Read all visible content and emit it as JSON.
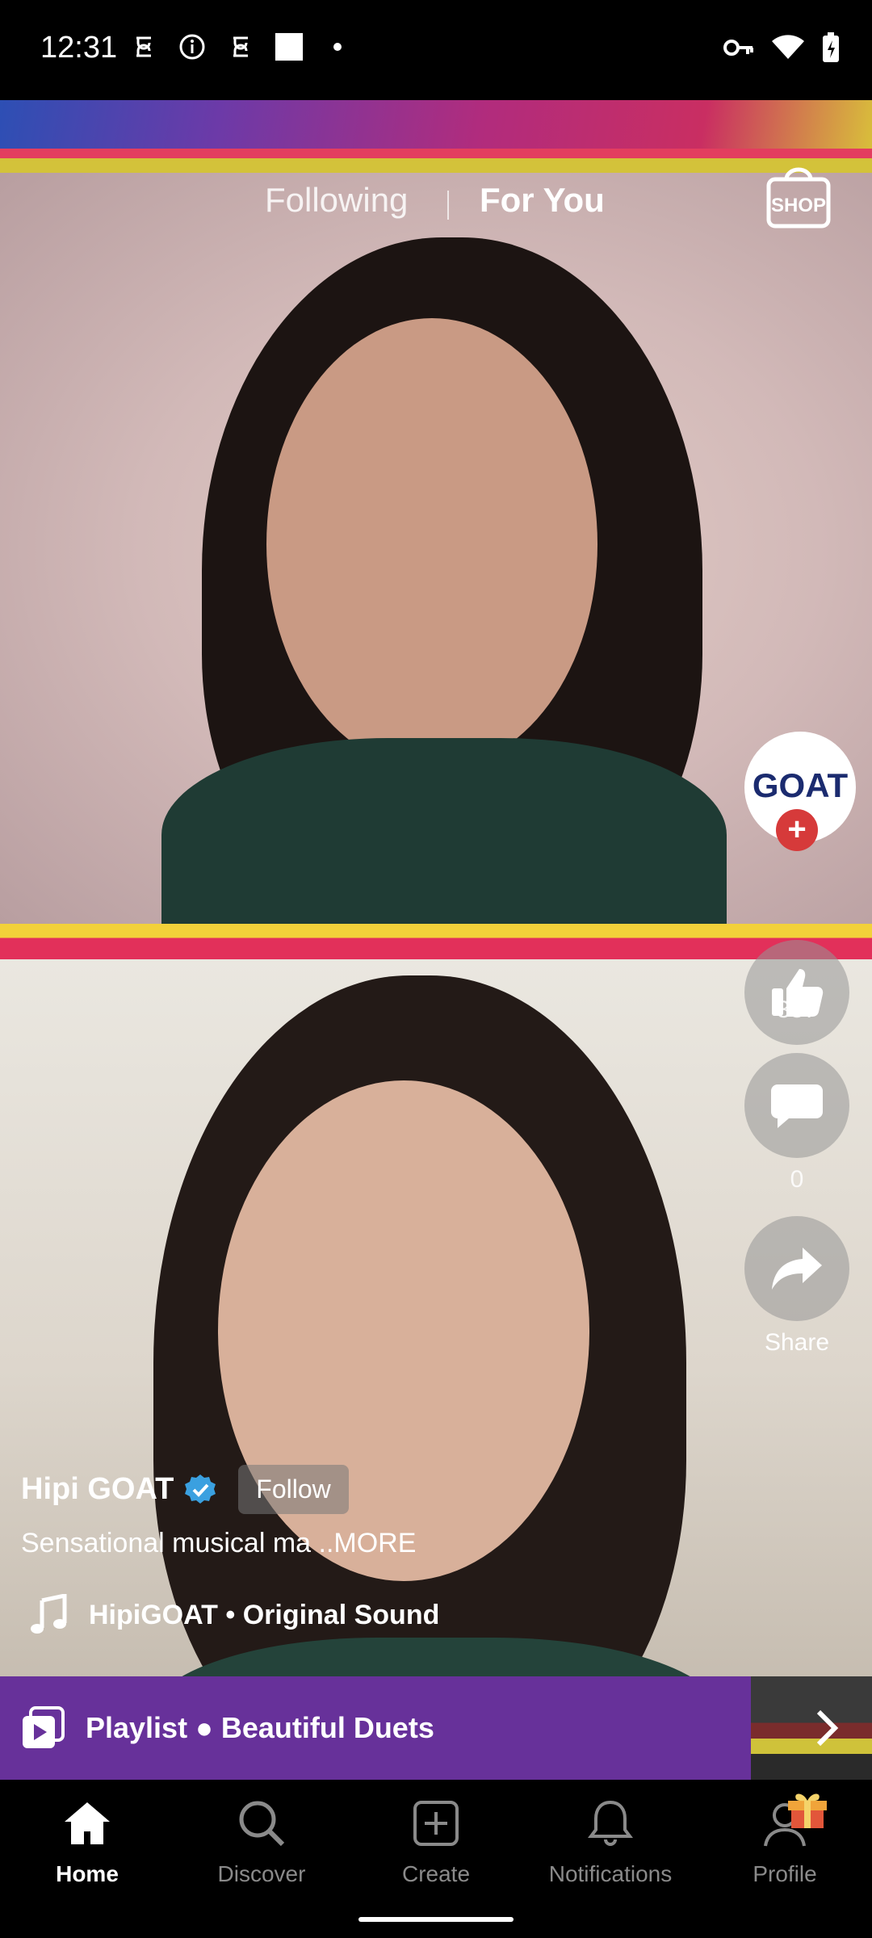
{
  "status_bar": {
    "time": "12:31",
    "left_icons": [
      "sync-icon",
      "info-icon",
      "sync-icon",
      "square-icon",
      "dot-icon"
    ],
    "right_icons": [
      "key-icon",
      "wifi-icon",
      "battery-icon"
    ]
  },
  "top_tabs": {
    "following": "Following",
    "for_you": "For You",
    "shop_label": "SHOP"
  },
  "creator_avatar": {
    "logo_text": "GOAT"
  },
  "actions": {
    "like_count": "387",
    "comment_count": "0",
    "share_label": "Share"
  },
  "post": {
    "creator_name": "Hipi GOAT",
    "follow_label": "Follow",
    "caption": "Sensational musical ma ..MORE",
    "sound": "HipiGOAT • Original Sound"
  },
  "playlist": {
    "label": "Playlist ● Beautiful Duets"
  },
  "nav": {
    "items": [
      {
        "label": "Home",
        "icon": "home-icon",
        "active": true
      },
      {
        "label": "Discover",
        "icon": "search-icon",
        "active": false
      },
      {
        "label": "Create",
        "icon": "create-icon",
        "active": false
      },
      {
        "label": "Notifications",
        "icon": "bell-icon",
        "active": false
      },
      {
        "label": "Profile",
        "icon": "profile-icon",
        "active": false
      }
    ]
  },
  "colors": {
    "playlist_bg": "#67319a",
    "plus_badge": "#d63a3a",
    "verified": "#3aa0e0"
  }
}
